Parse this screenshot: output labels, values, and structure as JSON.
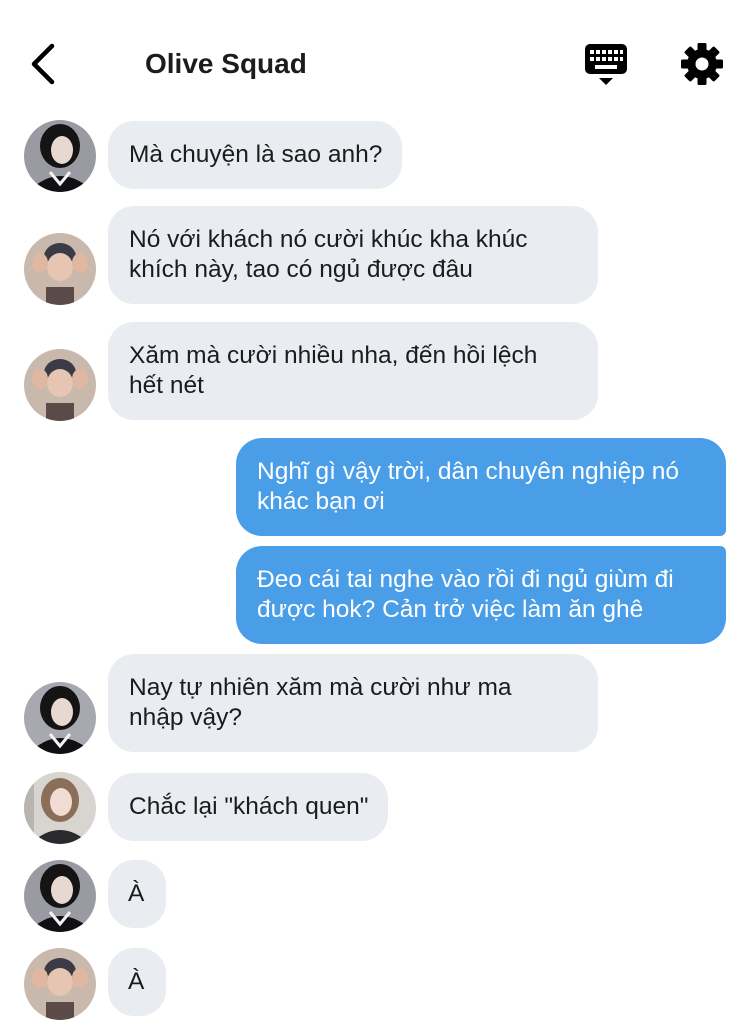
{
  "header": {
    "title": "Olive Squad",
    "icons": {
      "back": "back-chevron-icon",
      "keyboard": "keyboard-icon",
      "settings": "gear-icon"
    }
  },
  "colors": {
    "incoming_bubble": "#e9ecf0",
    "outgoing_bubble": "#4a9ee8",
    "text": "#1c1c1e"
  },
  "messages": [
    {
      "direction": "in",
      "avatar": "dark-hair-girl",
      "text": "Mà chuyện là sao anh?"
    },
    {
      "direction": "in",
      "avatar": "boy-hands",
      "text": "Nó với khách nó cười khúc kha khúc\nkhích này, tao có ngủ được đâu"
    },
    {
      "direction": "in",
      "avatar": "boy-hands",
      "text": "Xăm mà cười nhiều nha, đến hồi lệch\nhết nét"
    },
    {
      "direction": "out",
      "text": "Nghĩ gì vậy trời, dân chuyên nghiệp nó\nkhác bạn ơi"
    },
    {
      "direction": "out",
      "text": "Đeo cái tai nghe vào rồi đi ngủ giùm đi\nđược hok? Cản trở việc làm ăn ghê"
    },
    {
      "direction": "in",
      "avatar": "dark-hair-girl",
      "text": "Nay tự nhiên xăm mà cười như ma\nnhập vậy?"
    },
    {
      "direction": "in",
      "avatar": "light-hair-girl",
      "text": "Chắc lại \"khách quen\""
    },
    {
      "direction": "in",
      "avatar": "dark-hair-girl",
      "text": "À"
    },
    {
      "direction": "in",
      "avatar": "boy-hands",
      "text": "À"
    }
  ]
}
